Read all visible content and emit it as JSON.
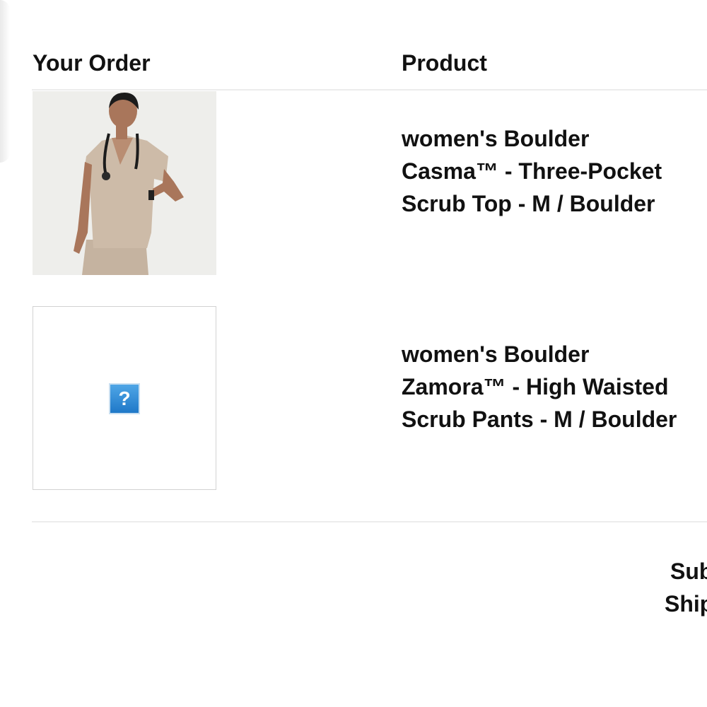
{
  "order_table": {
    "header_order": "Your Order",
    "header_product": "Product"
  },
  "items": [
    {
      "name": "women's Boulder Casma™ - Three-Pocket Scrub Top - M / Boulder",
      "image": "product-photo-scrub-top"
    },
    {
      "name": "women's Boulder Zamora™ - High Waisted Scrub Pants - M / Boulder",
      "image": "broken-image",
      "broken_glyph": "?"
    }
  ],
  "summary": {
    "subtotal_label": "Subtotal",
    "shipping_label": "Shipping"
  },
  "colors": {
    "scrub": "#c9b7a5",
    "broken_icon": "#2b8bd6"
  }
}
